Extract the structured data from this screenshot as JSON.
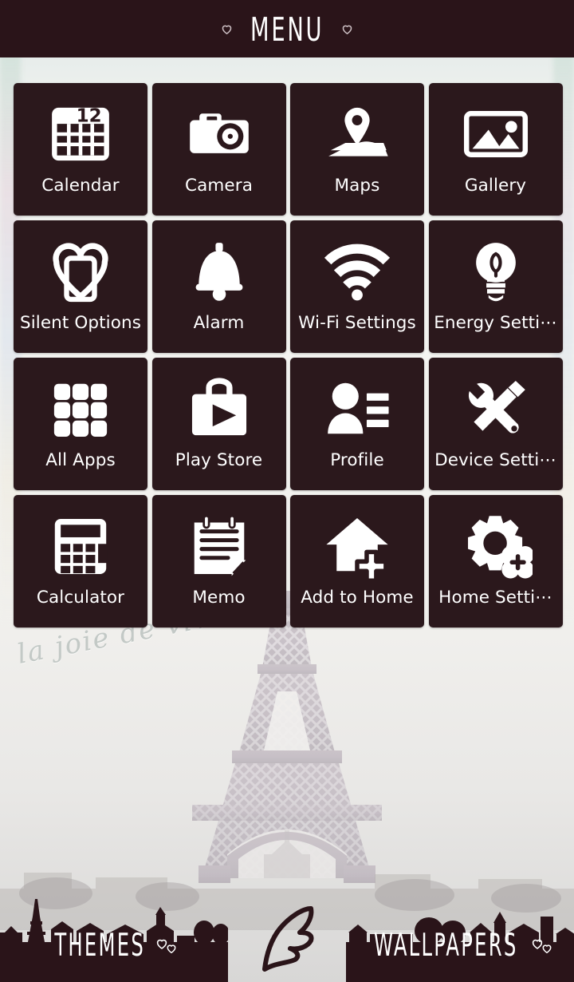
{
  "header": {
    "title": "MENU",
    "left_icon": "heart-icon",
    "right_icon": "heart-icon",
    "background_color": "#2a1419",
    "text_color": "#ffffff"
  },
  "theme": {
    "tile_color": "#2b181c",
    "tile_text_color": "#ffffff",
    "accent_color": "#2a1419",
    "wallpaper_tone": "#f2f1ee"
  },
  "wallpaper": {
    "script_text": "la joie de vivre",
    "script_color": "#c3c9c6",
    "subject": "eiffel-tower"
  },
  "grid": {
    "columns": 4,
    "rows": 4,
    "items": [
      {
        "label": "Calendar",
        "icon": "calendar-icon",
        "badge": "12"
      },
      {
        "label": "Camera",
        "icon": "camera-icon"
      },
      {
        "label": "Maps",
        "icon": "map-pin-icon"
      },
      {
        "label": "Gallery",
        "icon": "gallery-icon"
      },
      {
        "label": "Silent Options",
        "icon": "silent-phone-heart-icon"
      },
      {
        "label": "Alarm",
        "icon": "bell-icon"
      },
      {
        "label": "Wi-Fi Settings",
        "icon": "wifi-icon"
      },
      {
        "label": "Energy Setti⋯",
        "icon": "lightbulb-icon"
      },
      {
        "label": "All Apps",
        "icon": "app-grid-icon"
      },
      {
        "label": "Play Store",
        "icon": "play-store-bag-icon"
      },
      {
        "label": "Profile",
        "icon": "profile-person-icon"
      },
      {
        "label": "Device Setti⋯",
        "icon": "wrench-screwdriver-icon"
      },
      {
        "label": "Calculator",
        "icon": "calculator-icon"
      },
      {
        "label": "Memo",
        "icon": "notepad-icon"
      },
      {
        "label": "Add to Home",
        "icon": "house-plus-icon"
      },
      {
        "label": "Home Setti⋯",
        "icon": "gear-plus-icon"
      }
    ]
  },
  "bottom_bar": {
    "themes_label": "THEMES",
    "wallpapers_label": "WALLPAPERS",
    "center_icon": "feather-quill-icon",
    "heart_icon": "heart-icon",
    "panel_color": "#2a1419"
  }
}
